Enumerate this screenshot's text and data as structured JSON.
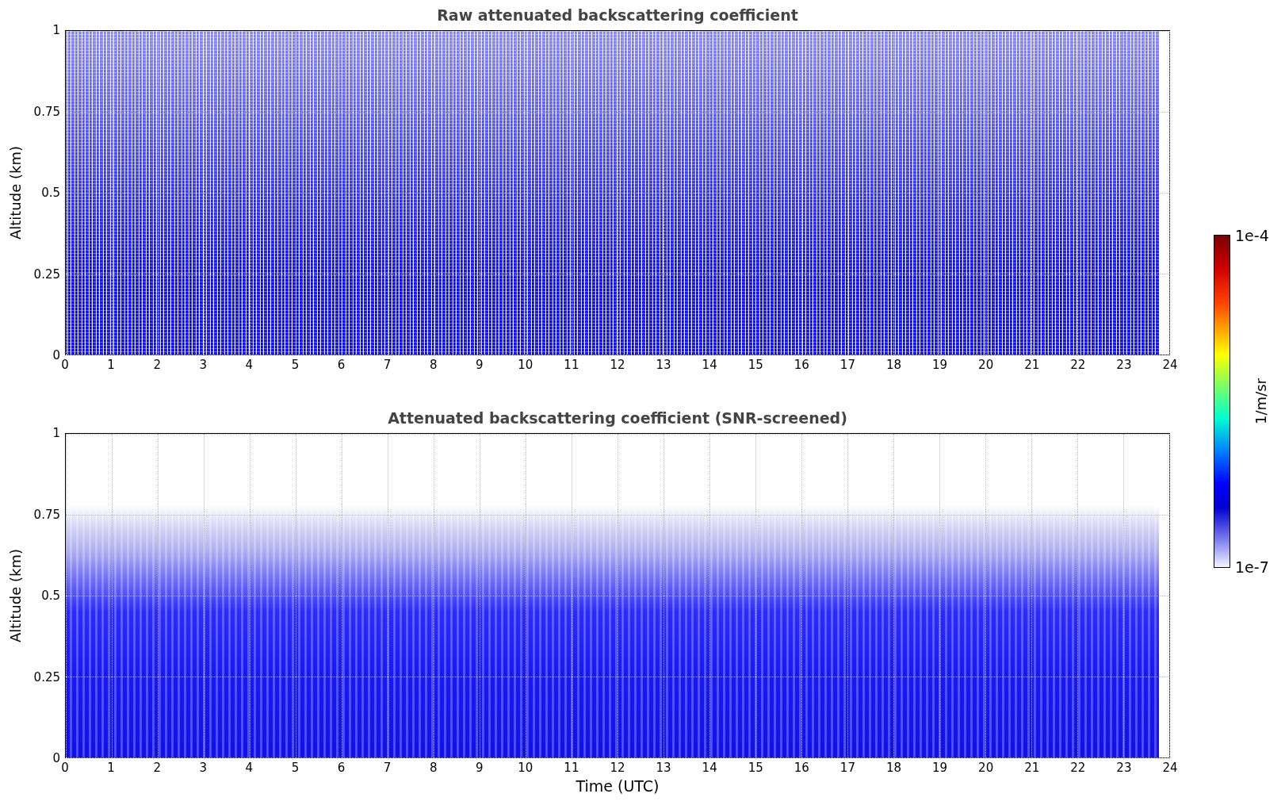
{
  "figure": {
    "panels": [
      {
        "title": "Raw attenuated backscattering coefficient",
        "ylabel": "Altitude (km)",
        "yticks": [
          "1",
          "0.75",
          "0.5",
          "0.25",
          "0"
        ],
        "xticks": [
          "0",
          "1",
          "2",
          "3",
          "4",
          "5",
          "6",
          "7",
          "8",
          "9",
          "10",
          "11",
          "12",
          "13",
          "14",
          "15",
          "16",
          "17",
          "18",
          "19",
          "20",
          "21",
          "22",
          "23",
          "24"
        ],
        "kind": "raw"
      },
      {
        "title": "Attenuated backscattering coefficient (SNR-screened)",
        "ylabel": "Altitude (km)",
        "yticks": [
          "1",
          "0.75",
          "0.5",
          "0.25",
          "0"
        ],
        "xticks": [
          "0",
          "1",
          "2",
          "3",
          "4",
          "5",
          "6",
          "7",
          "8",
          "9",
          "10",
          "11",
          "12",
          "13",
          "14",
          "15",
          "16",
          "17",
          "18",
          "19",
          "20",
          "21",
          "22",
          "23",
          "24"
        ],
        "kind": "screened"
      }
    ],
    "xlabel": "Time (UTC)",
    "colorbar": {
      "label": "1/m/sr",
      "max_label": "1e-4",
      "min_label": "1e-7"
    }
  }
}
